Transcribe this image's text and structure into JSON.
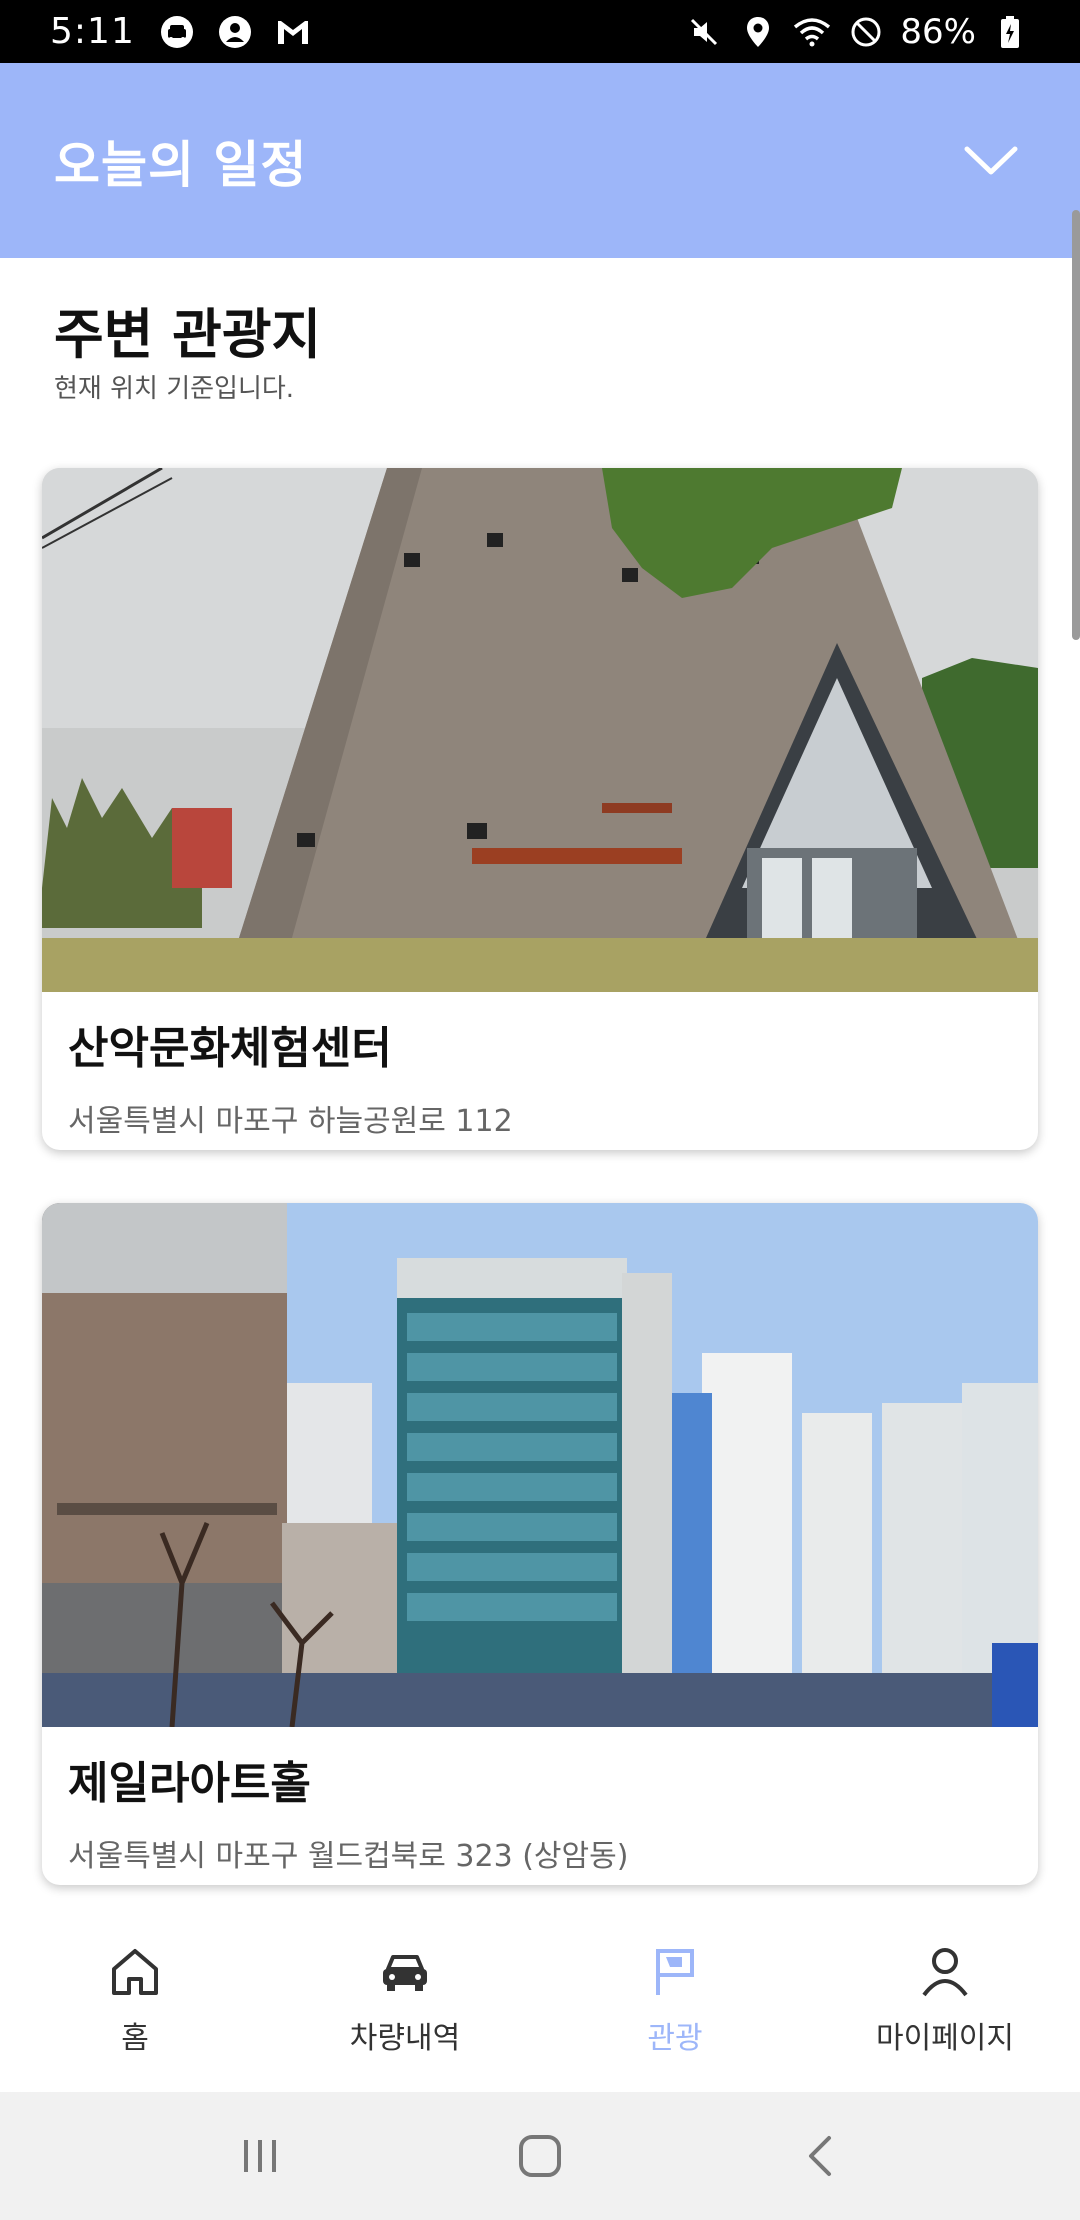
{
  "status_bar": {
    "time": "5:11",
    "battery": "86%",
    "left_icons": [
      "car-icon",
      "account-circle-icon",
      "gmail-icon"
    ],
    "right_icons": [
      "mute-icon",
      "location-icon",
      "wifi-icon",
      "do-not-disturb-icon",
      "battery-icon"
    ]
  },
  "header": {
    "title": "오늘의 일정",
    "toggle_icon": "chevron-down-icon"
  },
  "section": {
    "title": "주변 관광지",
    "subtitle": "현재 위치 기준입니다."
  },
  "places": [
    {
      "name": "산악문화체험센터",
      "address": "서울특별시 마포구 하늘공원로 112"
    },
    {
      "name": "제일라아트홀",
      "address": "서울특별시 마포구 월드컵북로 323 (상암동)"
    }
  ],
  "bottom_nav": {
    "items": [
      {
        "label": "홈",
        "icon": "home-icon",
        "active": false
      },
      {
        "label": "차량내역",
        "icon": "car-icon",
        "active": false
      },
      {
        "label": "관광",
        "icon": "flag-icon",
        "active": true
      },
      {
        "label": "마이페이지",
        "icon": "person-icon",
        "active": false
      }
    ]
  },
  "system_nav": [
    "recent-apps-icon",
    "home-button-icon",
    "back-icon"
  ],
  "colors": {
    "accent": "#9db6f9",
    "header_bg": "#9db6f9",
    "status_bar_bg": "#000000",
    "system_nav_bg": "#f1f1f1"
  }
}
